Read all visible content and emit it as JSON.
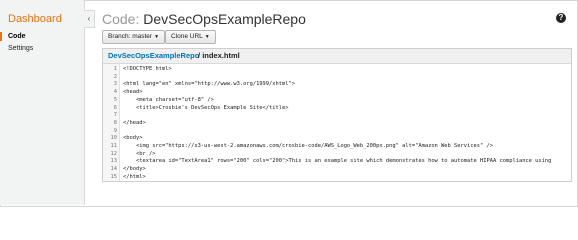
{
  "sidebar": {
    "title": "Dashboard",
    "items": [
      {
        "label": "Code",
        "active": true
      },
      {
        "label": "Settings",
        "active": false
      }
    ],
    "collapse_icon": "chevron-left-icon",
    "accent_color": "#ec7211"
  },
  "header": {
    "title_prefix": "Code:",
    "title": "DevSecOpsExampleRepo",
    "help_icon": "question-circle-icon"
  },
  "toolbar": {
    "branch_label": "Branch: master",
    "clone_label": "Clone URL"
  },
  "breadcrumb": {
    "repo": "DevSecOpsExampleRepo",
    "separator": "/",
    "file": "index.html"
  },
  "code": {
    "line_numbers": [
      "1",
      "2",
      "3",
      "4",
      "5",
      "6",
      "7",
      "8",
      "9",
      "10",
      "11",
      "12",
      "13",
      "14",
      "15"
    ],
    "lines": [
      "<!DOCTYPE html>",
      "",
      "<html lang=\"en\" xmlns=\"http://www.w3.org/1999/xhtml\">",
      "<head>",
      "    <meta charset=\"utf-8\" />",
      "    <title>Crosbie's DevSecOps Example Site</title>",
      "",
      "</head>",
      "",
      "<body>",
      "    <img src=\"https://s3-us-west-2.amazonaws.com/crosbie-code/AWS_Logo_Web_200px.png\" alt=\"Amazon Web Services\" />",
      "    <br />",
      "    <textarea id=\"TextArea1\" rows=\"200\" cols=\"200\">This is an example site which demonstrates how to automate HIPAA compliance using",
      "</body>",
      "</html>"
    ]
  }
}
